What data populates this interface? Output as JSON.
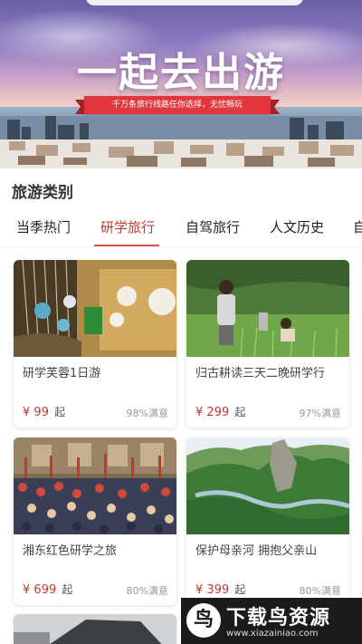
{
  "banner": {
    "title": "一起去出游",
    "ribbon_text": "千万条旅行线路任你选择，无忧畅玩"
  },
  "section": {
    "title": "旅游类别"
  },
  "tabs": [
    {
      "label": "当季热门",
      "active": false
    },
    {
      "label": "研学旅行",
      "active": true
    },
    {
      "label": "自驾旅行",
      "active": false
    },
    {
      "label": "人文历史",
      "active": false
    },
    {
      "label": "自",
      "active": false
    }
  ],
  "products": [
    {
      "name": "研学芙蓉1日游",
      "currency": "¥",
      "price": "99",
      "unit": "起",
      "satisfaction": "98%满意"
    },
    {
      "name": "归古耕读三天二晚研学行",
      "currency": "¥",
      "price": "299",
      "unit": "起",
      "satisfaction": "97%满意"
    },
    {
      "name": "湘东红色研学之旅",
      "currency": "¥",
      "price": "699",
      "unit": "起",
      "satisfaction": "80%满意"
    },
    {
      "name": "保护母亲河 拥抱父亲山",
      "currency": "¥",
      "price": "399",
      "unit": "起",
      "satisfaction": "80%满意"
    }
  ],
  "watermark": {
    "title": "下载鸟资源",
    "url": "www.xiazainiao.com"
  },
  "colors": {
    "accent": "#c0392b",
    "tab_underline": "#d9534f",
    "ribbon": "#e2363c"
  }
}
